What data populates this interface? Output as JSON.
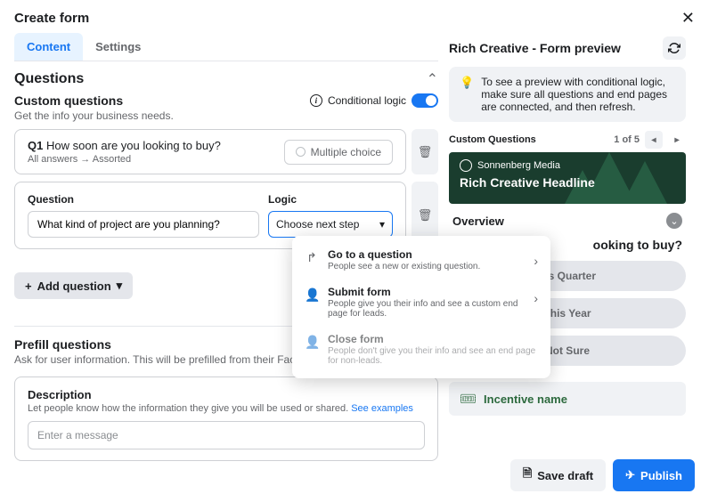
{
  "header": {
    "title": "Create form"
  },
  "tabs": {
    "content": "Content",
    "settings": "Settings"
  },
  "questions": {
    "title": "Questions",
    "custom": {
      "title": "Custom questions",
      "subtitle": "Get the info your business needs.",
      "conditional_label": "Conditional logic"
    },
    "q1": {
      "prefix": "Q1",
      "text": "How soon are you looking to buy?",
      "sub": "All answers → Assorted",
      "type": "Multiple choice"
    },
    "q2": {
      "question_label": "Question",
      "logic_label": "Logic",
      "question_value": "What kind of project are you planning?",
      "logic_placeholder": "Choose next step"
    },
    "add_label": "Add question"
  },
  "dropdown": {
    "items": [
      {
        "title": "Go to a question",
        "sub": "People see a new or existing question."
      },
      {
        "title": "Submit form",
        "sub": "People give you their info and see a custom end page for leads."
      },
      {
        "title": "Close form",
        "sub": "People don't give you their info and see an end page for non-leads."
      }
    ]
  },
  "prefill": {
    "title": "Prefill questions",
    "sub": "Ask for user information. This will be prefilled from their Facebook account.",
    "desc_title": "Description",
    "desc_sub": "Let people know how the information they give you will be used or shared. ",
    "desc_link": "See examples",
    "desc_placeholder": "Enter a message"
  },
  "preview": {
    "title": "Rich Creative - Form preview",
    "tip": "To see a preview with conditional logic, make sure all questions and end pages are connected, and then refresh.",
    "pager_label": "Custom Questions",
    "pager_count": "1 of 5",
    "brand": "Sonnenberg Media",
    "headline": "Rich Creative Headline",
    "overview": "Overview",
    "question": "ooking to buy?",
    "answers": [
      "his Quarter",
      "This Year",
      "Not Sure"
    ],
    "incentive": "Incentive name"
  },
  "footer": {
    "save": "Save draft",
    "publish": "Publish"
  }
}
